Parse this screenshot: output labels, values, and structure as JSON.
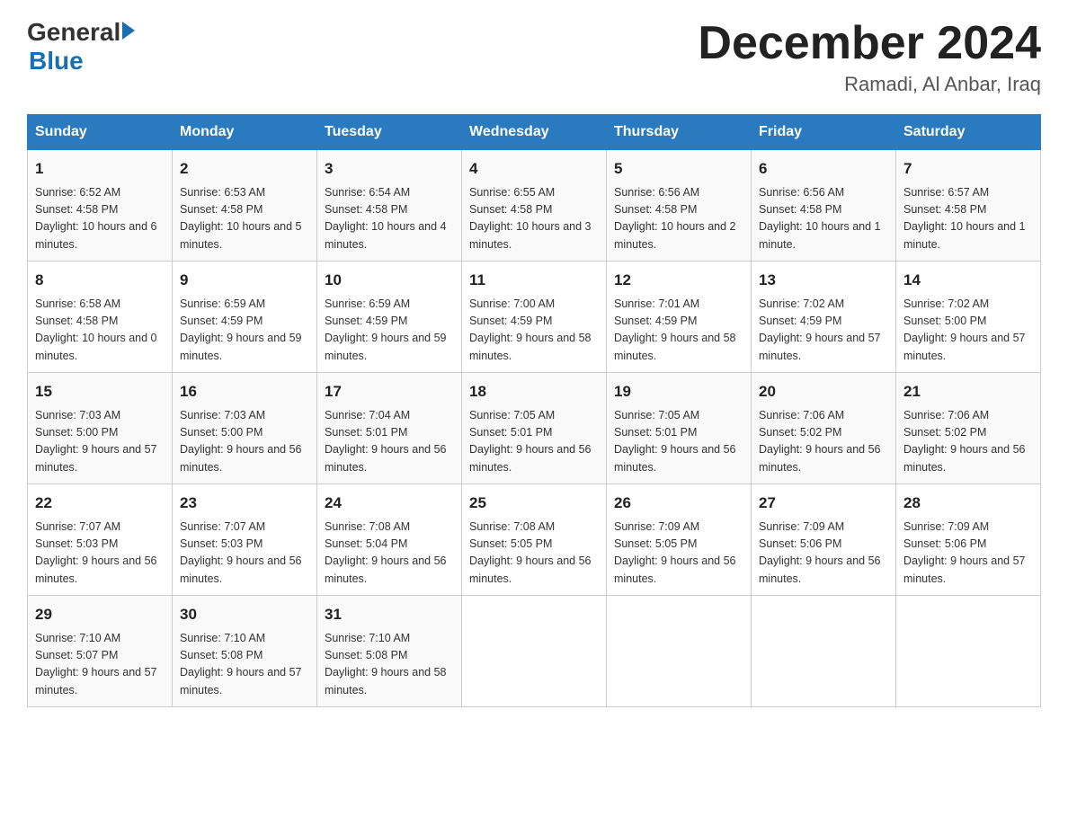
{
  "header": {
    "logo_general": "General",
    "logo_blue": "Blue",
    "month_title": "December 2024",
    "location": "Ramadi, Al Anbar, Iraq"
  },
  "days_of_week": [
    "Sunday",
    "Monday",
    "Tuesday",
    "Wednesday",
    "Thursday",
    "Friday",
    "Saturday"
  ],
  "weeks": [
    [
      {
        "day": "1",
        "sunrise": "6:52 AM",
        "sunset": "4:58 PM",
        "daylight": "10 hours and 6 minutes."
      },
      {
        "day": "2",
        "sunrise": "6:53 AM",
        "sunset": "4:58 PM",
        "daylight": "10 hours and 5 minutes."
      },
      {
        "day": "3",
        "sunrise": "6:54 AM",
        "sunset": "4:58 PM",
        "daylight": "10 hours and 4 minutes."
      },
      {
        "day": "4",
        "sunrise": "6:55 AM",
        "sunset": "4:58 PM",
        "daylight": "10 hours and 3 minutes."
      },
      {
        "day": "5",
        "sunrise": "6:56 AM",
        "sunset": "4:58 PM",
        "daylight": "10 hours and 2 minutes."
      },
      {
        "day": "6",
        "sunrise": "6:56 AM",
        "sunset": "4:58 PM",
        "daylight": "10 hours and 1 minute."
      },
      {
        "day": "7",
        "sunrise": "6:57 AM",
        "sunset": "4:58 PM",
        "daylight": "10 hours and 1 minute."
      }
    ],
    [
      {
        "day": "8",
        "sunrise": "6:58 AM",
        "sunset": "4:58 PM",
        "daylight": "10 hours and 0 minutes."
      },
      {
        "day": "9",
        "sunrise": "6:59 AM",
        "sunset": "4:59 PM",
        "daylight": "9 hours and 59 minutes."
      },
      {
        "day": "10",
        "sunrise": "6:59 AM",
        "sunset": "4:59 PM",
        "daylight": "9 hours and 59 minutes."
      },
      {
        "day": "11",
        "sunrise": "7:00 AM",
        "sunset": "4:59 PM",
        "daylight": "9 hours and 58 minutes."
      },
      {
        "day": "12",
        "sunrise": "7:01 AM",
        "sunset": "4:59 PM",
        "daylight": "9 hours and 58 minutes."
      },
      {
        "day": "13",
        "sunrise": "7:02 AM",
        "sunset": "4:59 PM",
        "daylight": "9 hours and 57 minutes."
      },
      {
        "day": "14",
        "sunrise": "7:02 AM",
        "sunset": "5:00 PM",
        "daylight": "9 hours and 57 minutes."
      }
    ],
    [
      {
        "day": "15",
        "sunrise": "7:03 AM",
        "sunset": "5:00 PM",
        "daylight": "9 hours and 57 minutes."
      },
      {
        "day": "16",
        "sunrise": "7:03 AM",
        "sunset": "5:00 PM",
        "daylight": "9 hours and 56 minutes."
      },
      {
        "day": "17",
        "sunrise": "7:04 AM",
        "sunset": "5:01 PM",
        "daylight": "9 hours and 56 minutes."
      },
      {
        "day": "18",
        "sunrise": "7:05 AM",
        "sunset": "5:01 PM",
        "daylight": "9 hours and 56 minutes."
      },
      {
        "day": "19",
        "sunrise": "7:05 AM",
        "sunset": "5:01 PM",
        "daylight": "9 hours and 56 minutes."
      },
      {
        "day": "20",
        "sunrise": "7:06 AM",
        "sunset": "5:02 PM",
        "daylight": "9 hours and 56 minutes."
      },
      {
        "day": "21",
        "sunrise": "7:06 AM",
        "sunset": "5:02 PM",
        "daylight": "9 hours and 56 minutes."
      }
    ],
    [
      {
        "day": "22",
        "sunrise": "7:07 AM",
        "sunset": "5:03 PM",
        "daylight": "9 hours and 56 minutes."
      },
      {
        "day": "23",
        "sunrise": "7:07 AM",
        "sunset": "5:03 PM",
        "daylight": "9 hours and 56 minutes."
      },
      {
        "day": "24",
        "sunrise": "7:08 AM",
        "sunset": "5:04 PM",
        "daylight": "9 hours and 56 minutes."
      },
      {
        "day": "25",
        "sunrise": "7:08 AM",
        "sunset": "5:05 PM",
        "daylight": "9 hours and 56 minutes."
      },
      {
        "day": "26",
        "sunrise": "7:09 AM",
        "sunset": "5:05 PM",
        "daylight": "9 hours and 56 minutes."
      },
      {
        "day": "27",
        "sunrise": "7:09 AM",
        "sunset": "5:06 PM",
        "daylight": "9 hours and 56 minutes."
      },
      {
        "day": "28",
        "sunrise": "7:09 AM",
        "sunset": "5:06 PM",
        "daylight": "9 hours and 57 minutes."
      }
    ],
    [
      {
        "day": "29",
        "sunrise": "7:10 AM",
        "sunset": "5:07 PM",
        "daylight": "9 hours and 57 minutes."
      },
      {
        "day": "30",
        "sunrise": "7:10 AM",
        "sunset": "5:08 PM",
        "daylight": "9 hours and 57 minutes."
      },
      {
        "day": "31",
        "sunrise": "7:10 AM",
        "sunset": "5:08 PM",
        "daylight": "9 hours and 58 minutes."
      },
      null,
      null,
      null,
      null
    ]
  ]
}
